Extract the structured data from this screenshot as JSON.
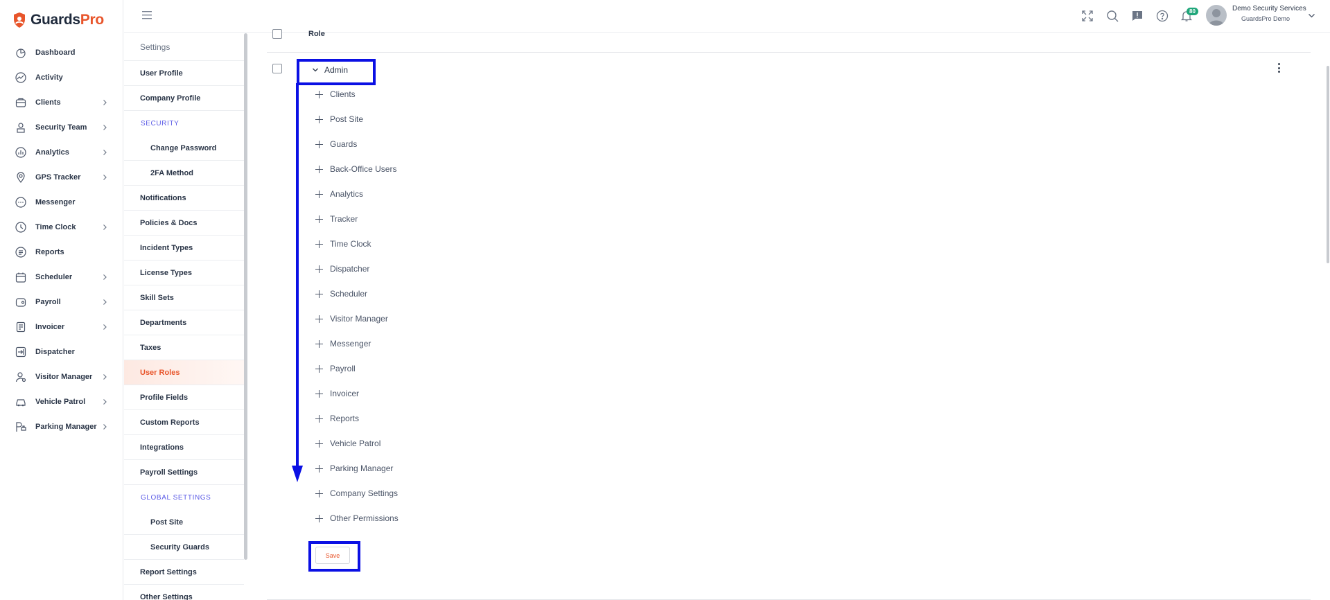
{
  "brand": {
    "name_part1": "Guards",
    "name_part2": "Pro",
    "accent": "#e8552b"
  },
  "nav": {
    "items": [
      {
        "label": "Dashboard",
        "icon": "dashboard-icon",
        "has_children": false
      },
      {
        "label": "Activity",
        "icon": "activity-icon",
        "has_children": false
      },
      {
        "label": "Clients",
        "icon": "clients-icon",
        "has_children": true
      },
      {
        "label": "Security Team",
        "icon": "security-team-icon",
        "has_children": true
      },
      {
        "label": "Analytics",
        "icon": "analytics-icon",
        "has_children": true
      },
      {
        "label": "GPS Tracker",
        "icon": "gps-tracker-icon",
        "has_children": true
      },
      {
        "label": "Messenger",
        "icon": "messenger-icon",
        "has_children": false
      },
      {
        "label": "Time Clock",
        "icon": "time-clock-icon",
        "has_children": true
      },
      {
        "label": "Reports",
        "icon": "reports-icon",
        "has_children": false
      },
      {
        "label": "Scheduler",
        "icon": "scheduler-icon",
        "has_children": true
      },
      {
        "label": "Payroll",
        "icon": "payroll-icon",
        "has_children": true
      },
      {
        "label": "Invoicer",
        "icon": "invoicer-icon",
        "has_children": true
      },
      {
        "label": "Dispatcher",
        "icon": "dispatcher-icon",
        "has_children": false
      },
      {
        "label": "Visitor Manager",
        "icon": "visitor-manager-icon",
        "has_children": true
      },
      {
        "label": "Vehicle Patrol",
        "icon": "vehicle-patrol-icon",
        "has_children": true
      },
      {
        "label": "Parking Manager",
        "icon": "parking-manager-icon",
        "has_children": true
      }
    ]
  },
  "settings": {
    "heading": "Settings",
    "user_profile": "User Profile",
    "company_profile": "Company Profile",
    "security_section": "SECURITY",
    "change_password": "Change Password",
    "twofa": "2FA Method",
    "notifications": "Notifications",
    "policies": "Policies & Docs",
    "incident_types": "Incident Types",
    "license_types": "License Types",
    "skill_sets": "Skill Sets",
    "departments": "Departments",
    "taxes": "Taxes",
    "user_roles": "User Roles",
    "profile_fields": "Profile Fields",
    "custom_reports": "Custom Reports",
    "integrations": "Integrations",
    "payroll_settings": "Payroll Settings",
    "global_section": "GLOBAL SETTINGS",
    "post_site": "Post Site",
    "security_guards": "Security Guards",
    "report_settings": "Report Settings",
    "other_settings": "Other Settings"
  },
  "topbar": {
    "notification_count": "80",
    "company": "Demo Security Services",
    "user": "GuardsPro Demo"
  },
  "roles": {
    "column_header": "Role",
    "role_name": "Admin",
    "permissions": [
      "Clients",
      "Post Site",
      "Guards",
      "Back-Office Users",
      "Analytics",
      "Tracker",
      "Time Clock",
      "Dispatcher",
      "Scheduler",
      "Visitor Manager",
      "Messenger",
      "Payroll",
      "Invoicer",
      "Reports",
      "Vehicle Patrol",
      "Parking Manager",
      "Company Settings",
      "Other Permissions"
    ],
    "save_label": "Save"
  }
}
